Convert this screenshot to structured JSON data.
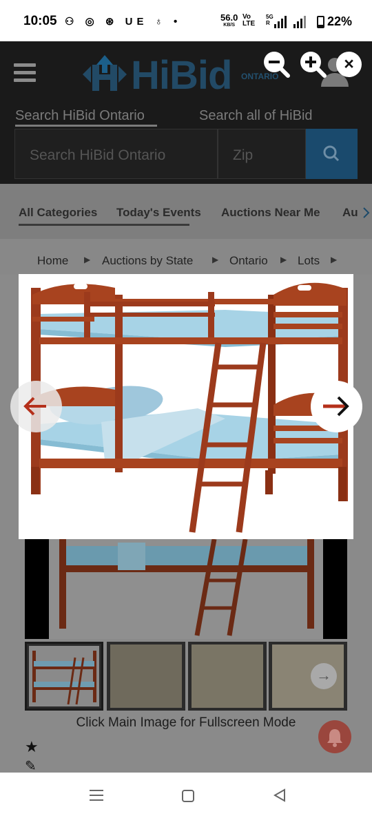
{
  "status_bar": {
    "time": "10:05",
    "notification_icons": "⚇ ◎ ⊛ UE ♁ •",
    "speed_value": "56.0",
    "speed_unit": "KB/S",
    "network_top": "Vo",
    "network_bottom": "LTE",
    "network_5g": "5G",
    "network_r": "R",
    "battery": "22%"
  },
  "header": {
    "logo_text": "HiBid",
    "logo_sub": "ONTARIO",
    "search_tab_local": "Search HiBid Ontario",
    "search_tab_all": "Search all of HiBid",
    "search_placeholder": "Search HiBid Ontario",
    "zip_placeholder": "Zip"
  },
  "categories": [
    "All Categories",
    "Today's Events",
    "Auctions Near Me",
    "Au"
  ],
  "breadcrumbs": [
    "Home",
    "Auctions by State",
    "Ontario",
    "Lots"
  ],
  "gallery": {
    "caption": "Click Main Image for Fullscreen Mode",
    "thumbnail_count": 4
  },
  "icons": {
    "zoom_out": "zoom-out-icon",
    "zoom_in": "zoom-in-icon",
    "close": "close-icon",
    "prev": "arrow-left-icon",
    "next": "arrow-right-icon",
    "star": "star-icon",
    "pencil": "pencil-icon",
    "bell": "bell-icon"
  },
  "colors": {
    "brand_blue": "#1b4f72",
    "wood": "#9c3a1c",
    "mattress": "#a7d3e6",
    "arrow_accent": "#b5301b"
  }
}
